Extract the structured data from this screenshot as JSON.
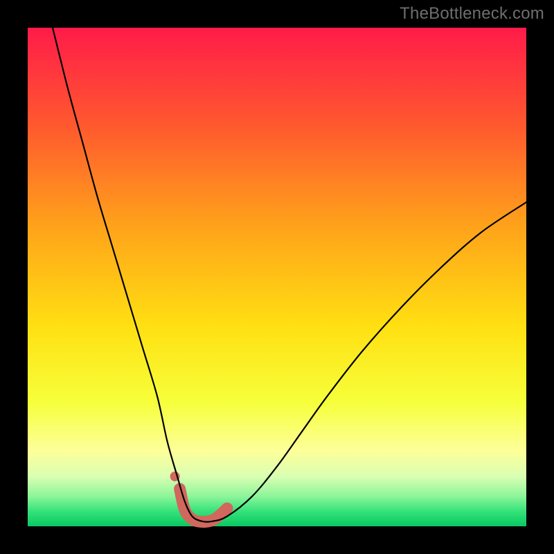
{
  "watermark": "TheBottleneck.com",
  "gradient": {
    "stops": [
      {
        "offset": 0.0,
        "color": "#ff1b49"
      },
      {
        "offset": 0.2,
        "color": "#ff5a2e"
      },
      {
        "offset": 0.4,
        "color": "#ffa31a"
      },
      {
        "offset": 0.6,
        "color": "#ffe012"
      },
      {
        "offset": 0.75,
        "color": "#f6ff3a"
      },
      {
        "offset": 0.85,
        "color": "#fdff9a"
      },
      {
        "offset": 0.9,
        "color": "#d9ffb2"
      },
      {
        "offset": 0.94,
        "color": "#8cf59a"
      },
      {
        "offset": 0.97,
        "color": "#35e27a"
      },
      {
        "offset": 1.0,
        "color": "#08c962"
      }
    ]
  },
  "chart_data": {
    "type": "line",
    "title": "",
    "xlabel": "",
    "ylabel": "",
    "xlim": [
      0,
      100
    ],
    "ylim": [
      0,
      100
    ],
    "series": [
      {
        "name": "bottleneck-curve",
        "x": [
          5,
          8,
          11,
          14,
          17,
          20,
          23,
          26,
          28,
          30,
          31.5,
          33,
          35,
          37,
          40,
          45,
          50,
          55,
          60,
          67,
          75,
          83,
          91,
          100
        ],
        "values": [
          100,
          88,
          77,
          66,
          56,
          46,
          36,
          26,
          17,
          10,
          5,
          2,
          1,
          1,
          2,
          6,
          12,
          19,
          26,
          35,
          44,
          52,
          59,
          65
        ]
      },
      {
        "name": "optimal-band-markers",
        "x": [
          30.5,
          31.5,
          33,
          35,
          37,
          38.5,
          40
        ],
        "values": [
          7.5,
          3.3,
          1.4,
          0.9,
          1.2,
          2.2,
          3.6
        ]
      }
    ],
    "marker_color": "#d0685e",
    "curve_color": "#000000"
  }
}
